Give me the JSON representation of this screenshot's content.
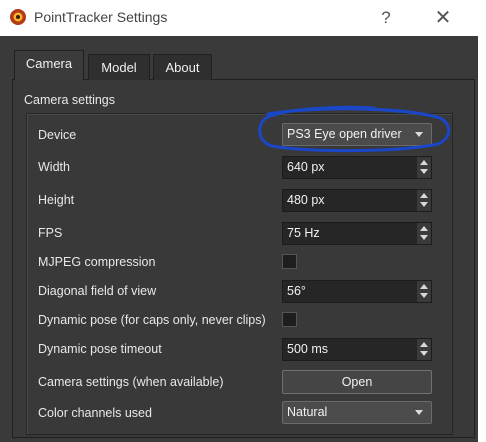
{
  "window": {
    "title": "PointTracker Settings",
    "icon": "app-icon",
    "help_label": "?",
    "close_label": "✕"
  },
  "tabs": [
    {
      "label": "Camera",
      "active": true
    },
    {
      "label": "Model",
      "active": false
    },
    {
      "label": "About",
      "active": false
    }
  ],
  "camera_settings": {
    "group_title": "Camera settings",
    "rows": {
      "device": {
        "label": "Device",
        "value": "PS3 Eye open driver"
      },
      "width": {
        "label": "Width",
        "value": "640 px"
      },
      "height": {
        "label": "Height",
        "value": "480 px"
      },
      "fps": {
        "label": "FPS",
        "value": "75 Hz"
      },
      "mjpeg": {
        "label": "MJPEG compression",
        "checked": false
      },
      "fov": {
        "label": "Diagonal field of view",
        "value": "56°"
      },
      "dynamic_pose": {
        "label": "Dynamic pose (for caps only, never clips)",
        "checked": false
      },
      "dynamic_pose_timeout": {
        "label": "Dynamic pose timeout",
        "value": "500 ms"
      },
      "camera_settings_open": {
        "label": "Camera settings (when available)",
        "button": "Open"
      },
      "color_channels": {
        "label": "Color channels used",
        "value": "Natural"
      }
    }
  },
  "colors": {
    "background": "#3a3a3a",
    "annotation": "#1a47c8"
  }
}
